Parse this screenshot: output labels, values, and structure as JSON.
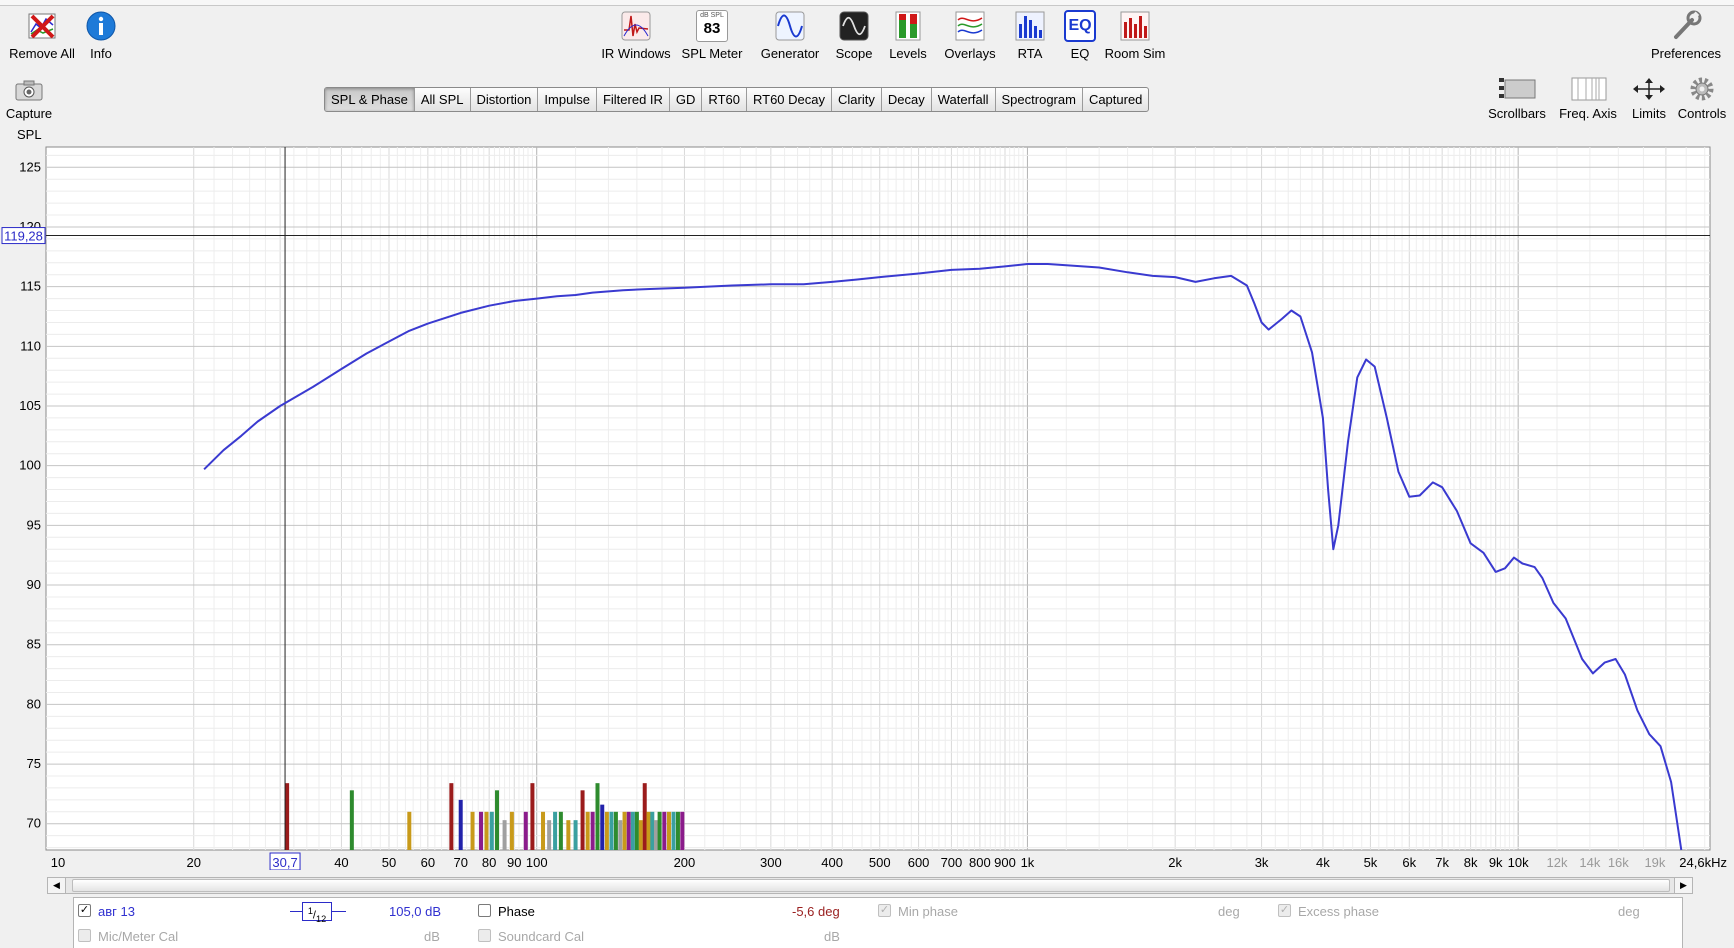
{
  "toolbar_left": [
    {
      "id": "remove-all",
      "label": "Remove All",
      "icon": "remove-all-icon"
    },
    {
      "id": "info",
      "label": "Info",
      "icon": "info-icon"
    }
  ],
  "toolbar_center": [
    {
      "id": "ir-windows",
      "label": "IR Windows",
      "icon": "ir-windows-icon"
    },
    {
      "id": "spl-meter",
      "label": "SPL Meter",
      "icon": "spl-meter-icon",
      "icon_top": "dB SPL",
      "icon_value": "83"
    },
    {
      "id": "generator",
      "label": "Generator",
      "icon": "generator-icon"
    },
    {
      "id": "scope",
      "label": "Scope",
      "icon": "scope-icon"
    },
    {
      "id": "levels",
      "label": "Levels",
      "icon": "levels-icon"
    },
    {
      "id": "overlays",
      "label": "Overlays",
      "icon": "overlays-icon"
    },
    {
      "id": "rta",
      "label": "RTA",
      "icon": "rta-icon"
    },
    {
      "id": "eq",
      "label": "EQ",
      "icon": "eq-icon",
      "icon_text": "EQ"
    },
    {
      "id": "room-sim",
      "label": "Room Sim",
      "icon": "room-sim-icon"
    }
  ],
  "toolbar_right": {
    "id": "preferences",
    "label": "Preferences",
    "icon": "wrench-icon"
  },
  "capture": {
    "label": "Capture",
    "icon": "camera-icon"
  },
  "view_buttons": [
    {
      "id": "scrollbars",
      "label": "Scrollbars",
      "icon": "scrollbars-icon"
    },
    {
      "id": "freq-axis",
      "label": "Freq. Axis",
      "icon": "freq-axis-icon"
    },
    {
      "id": "limits",
      "label": "Limits",
      "icon": "limits-icon"
    },
    {
      "id": "controls",
      "label": "Controls",
      "icon": "gear-icon"
    }
  ],
  "tabs": [
    {
      "label": "SPL & Phase",
      "active": true
    },
    {
      "label": "All SPL"
    },
    {
      "label": "Distortion"
    },
    {
      "label": "Impulse"
    },
    {
      "label": "Filtered IR"
    },
    {
      "label": "GD"
    },
    {
      "label": "RT60"
    },
    {
      "label": "RT60 Decay"
    },
    {
      "label": "Clarity"
    },
    {
      "label": "Decay"
    },
    {
      "label": "Waterfall"
    },
    {
      "label": "Spectrogram"
    },
    {
      "label": "Captured"
    }
  ],
  "chart_data": {
    "type": "line",
    "ylabel": "SPL",
    "ylim": [
      67.8,
      126.7
    ],
    "xlim": [
      10,
      24600
    ],
    "x_scale": "log",
    "grid": true,
    "y_ticks": [
      70,
      75,
      80,
      85,
      90,
      95,
      100,
      105,
      110,
      115,
      120,
      125
    ],
    "x_ticks": [
      {
        "label": "10",
        "x": 10
      },
      {
        "label": "20",
        "x": 20
      },
      {
        "label": "30,7",
        "x": 30.7,
        "cursor": true
      },
      {
        "label": "40",
        "x": 40
      },
      {
        "label": "50",
        "x": 50
      },
      {
        "label": "60",
        "x": 60
      },
      {
        "label": "70",
        "x": 70
      },
      {
        "label": "80",
        "x": 80
      },
      {
        "label": "90",
        "x": 90
      },
      {
        "label": "100",
        "x": 100
      },
      {
        "label": "200",
        "x": 200
      },
      {
        "label": "300",
        "x": 300
      },
      {
        "label": "400",
        "x": 400
      },
      {
        "label": "500",
        "x": 500
      },
      {
        "label": "600",
        "x": 600
      },
      {
        "label": "700",
        "x": 700
      },
      {
        "label": "800",
        "x": 800
      },
      {
        "label": "900",
        "x": 900
      },
      {
        "label": "1k",
        "x": 1000
      },
      {
        "label": "2k",
        "x": 2000
      },
      {
        "label": "3k",
        "x": 3000
      },
      {
        "label": "4k",
        "x": 4000
      },
      {
        "label": "5k",
        "x": 5000
      },
      {
        "label": "6k",
        "x": 6000
      },
      {
        "label": "7k",
        "x": 7000
      },
      {
        "label": "8k",
        "x": 8000
      },
      {
        "label": "9k",
        "x": 9000
      },
      {
        "label": "10k",
        "x": 10000
      },
      {
        "label": "12k",
        "x": 12000,
        "faded": true
      },
      {
        "label": "14k",
        "x": 14000,
        "faded": true
      },
      {
        "label": "16k",
        "x": 16000,
        "faded": true
      },
      {
        "label": "19k",
        "x": 19000,
        "faded": true
      },
      {
        "label": "24,6kHz",
        "x": 24600
      }
    ],
    "cursor": {
      "x": 30.7,
      "x_label": "30,7",
      "y": 119.28,
      "y_label": "119,28"
    },
    "series": [
      {
        "name": "авг 13",
        "color": "#3a3ad0",
        "points": [
          [
            21,
            99.7
          ],
          [
            23,
            101.3
          ],
          [
            25,
            102.5
          ],
          [
            27,
            103.7
          ],
          [
            30,
            105.0
          ],
          [
            35,
            106.6
          ],
          [
            40,
            108.1
          ],
          [
            45,
            109.4
          ],
          [
            50,
            110.4
          ],
          [
            55,
            111.3
          ],
          [
            60,
            111.9
          ],
          [
            70,
            112.8
          ],
          [
            80,
            113.4
          ],
          [
            90,
            113.8
          ],
          [
            100,
            114.0
          ],
          [
            110,
            114.2
          ],
          [
            120,
            114.3
          ],
          [
            130,
            114.5
          ],
          [
            150,
            114.7
          ],
          [
            170,
            114.8
          ],
          [
            200,
            114.9
          ],
          [
            250,
            115.1
          ],
          [
            300,
            115.2
          ],
          [
            350,
            115.2
          ],
          [
            400,
            115.4
          ],
          [
            450,
            115.6
          ],
          [
            500,
            115.8
          ],
          [
            600,
            116.1
          ],
          [
            700,
            116.4
          ],
          [
            800,
            116.5
          ],
          [
            900,
            116.7
          ],
          [
            1000,
            116.9
          ],
          [
            1100,
            116.9
          ],
          [
            1200,
            116.8
          ],
          [
            1400,
            116.6
          ],
          [
            1600,
            116.2
          ],
          [
            1800,
            115.9
          ],
          [
            2000,
            115.8
          ],
          [
            2200,
            115.4
          ],
          [
            2400,
            115.7
          ],
          [
            2600,
            115.9
          ],
          [
            2800,
            115.1
          ],
          [
            2900,
            113.6
          ],
          [
            3000,
            112.0
          ],
          [
            3100,
            111.4
          ],
          [
            3300,
            112.3
          ],
          [
            3450,
            113.0
          ],
          [
            3600,
            112.5
          ],
          [
            3800,
            109.5
          ],
          [
            4000,
            104.0
          ],
          [
            4100,
            98.0
          ],
          [
            4200,
            93.0
          ],
          [
            4300,
            95.0
          ],
          [
            4500,
            102.0
          ],
          [
            4700,
            107.4
          ],
          [
            4900,
            108.9
          ],
          [
            5100,
            108.3
          ],
          [
            5400,
            104.0
          ],
          [
            5700,
            99.5
          ],
          [
            6000,
            97.4
          ],
          [
            6300,
            97.5
          ],
          [
            6700,
            98.6
          ],
          [
            7000,
            98.2
          ],
          [
            7500,
            96.2
          ],
          [
            8000,
            93.5
          ],
          [
            8500,
            92.7
          ],
          [
            9000,
            91.1
          ],
          [
            9400,
            91.4
          ],
          [
            9800,
            92.3
          ],
          [
            10200,
            91.8
          ],
          [
            10800,
            91.5
          ],
          [
            11200,
            90.6
          ],
          [
            11800,
            88.5
          ],
          [
            12500,
            87.2
          ],
          [
            13500,
            83.8
          ],
          [
            14200,
            82.6
          ],
          [
            15000,
            83.5
          ],
          [
            15800,
            83.8
          ],
          [
            16500,
            82.5
          ],
          [
            17500,
            79.5
          ],
          [
            18500,
            77.5
          ],
          [
            19500,
            76.5
          ],
          [
            20500,
            73.5
          ],
          [
            21500,
            67.8
          ]
        ]
      }
    ],
    "distortion_bars": [
      {
        "x": 31,
        "h": 73.4,
        "color": "#9b1c1c"
      },
      {
        "x": 42,
        "h": 72.8,
        "color": "#2e8b2e"
      },
      {
        "x": 55,
        "h": 71.0,
        "color": "#c89a1a"
      },
      {
        "x": 67,
        "h": 73.4,
        "color": "#9b1c1c"
      },
      {
        "x": 70,
        "h": 72.0,
        "color": "#2222aa"
      },
      {
        "x": 74,
        "h": 71.0,
        "color": "#c89a1a"
      },
      {
        "x": 77,
        "h": 71.0,
        "color": "#8b1c8b"
      },
      {
        "x": 79,
        "h": 71.0,
        "color": "#c89a1a"
      },
      {
        "x": 81,
        "h": 71.0,
        "color": "#3aa0a0"
      },
      {
        "x": 83,
        "h": 72.8,
        "color": "#2e8b2e"
      },
      {
        "x": 86,
        "h": 70.3,
        "color": "#a0a0a0"
      },
      {
        "x": 89,
        "h": 71.0,
        "color": "#c89a1a"
      },
      {
        "x": 95,
        "h": 71.0,
        "color": "#8b1c8b"
      },
      {
        "x": 98,
        "h": 73.4,
        "color": "#9b1c1c"
      },
      {
        "x": 103,
        "h": 71.0,
        "color": "#c89a1a"
      },
      {
        "x": 106,
        "h": 70.3,
        "color": "#a0a0a0"
      },
      {
        "x": 109,
        "h": 71.0,
        "color": "#3aa0a0"
      },
      {
        "x": 112,
        "h": 71.0,
        "color": "#2e8b2e"
      },
      {
        "x": 116,
        "h": 70.3,
        "color": "#c89a1a"
      },
      {
        "x": 120,
        "h": 70.3,
        "color": "#3aa0a0"
      },
      {
        "x": 124,
        "h": 72.8,
        "color": "#9b1c1c"
      },
      {
        "x": 127,
        "h": 71.0,
        "color": "#c89a1a"
      },
      {
        "x": 130,
        "h": 71.0,
        "color": "#8b1c8b"
      },
      {
        "x": 133,
        "h": 73.4,
        "color": "#2e8b2e"
      },
      {
        "x": 136,
        "h": 71.6,
        "color": "#2222aa"
      },
      {
        "x": 139,
        "h": 71.0,
        "color": "#c89a1a"
      },
      {
        "x": 142,
        "h": 71.0,
        "color": "#3aa0a0"
      },
      {
        "x": 145,
        "h": 71.0,
        "color": "#2e8b2e"
      },
      {
        "x": 148,
        "h": 70.3,
        "color": "#a0a0a0"
      },
      {
        "x": 151,
        "h": 71.0,
        "color": "#c89a1a"
      },
      {
        "x": 154,
        "h": 71.0,
        "color": "#8b1c8b"
      },
      {
        "x": 157,
        "h": 71.0,
        "color": "#3aa0a0"
      },
      {
        "x": 160,
        "h": 71.0,
        "color": "#2e8b2e"
      },
      {
        "x": 163,
        "h": 70.3,
        "color": "#c89a1a"
      },
      {
        "x": 166,
        "h": 73.4,
        "color": "#9b1c1c"
      },
      {
        "x": 169,
        "h": 71.0,
        "color": "#c89a1a"
      },
      {
        "x": 172,
        "h": 71.0,
        "color": "#3aa0a0"
      },
      {
        "x": 175,
        "h": 70.3,
        "color": "#a0a0a0"
      },
      {
        "x": 178,
        "h": 71.0,
        "color": "#2e8b2e"
      },
      {
        "x": 182,
        "h": 71.0,
        "color": "#8b1c8b"
      },
      {
        "x": 186,
        "h": 71.0,
        "color": "#c89a1a"
      },
      {
        "x": 190,
        "h": 71.0,
        "color": "#3aa0a0"
      },
      {
        "x": 194,
        "h": 71.0,
        "color": "#2e8b2e"
      },
      {
        "x": 198,
        "h": 71.0,
        "color": "#8b1c8b"
      }
    ]
  },
  "controls_panel": {
    "row1": {
      "measurement_name": "авг 13",
      "measurement_checked": true,
      "smoothing_num": "1",
      "smoothing_den": "12",
      "offset_value": "105,0 dB",
      "phase_label": "Phase",
      "phase_value": "-5,6 deg",
      "min_phase_label": "Min phase",
      "min_phase_unit": "deg",
      "excess_phase_label": "Excess phase",
      "excess_phase_unit": "deg"
    },
    "row2": {
      "mic_cal_label": "Mic/Meter Cal",
      "mic_cal_unit": "dB",
      "soundcard_cal_label": "Soundcard Cal",
      "soundcard_cal_unit": "dB"
    }
  },
  "colors": {
    "trace": "#3a3ad0",
    "grid": "#d9d9d9",
    "grid_major": "#c0c0c0",
    "accent": "#2b2bc8"
  }
}
